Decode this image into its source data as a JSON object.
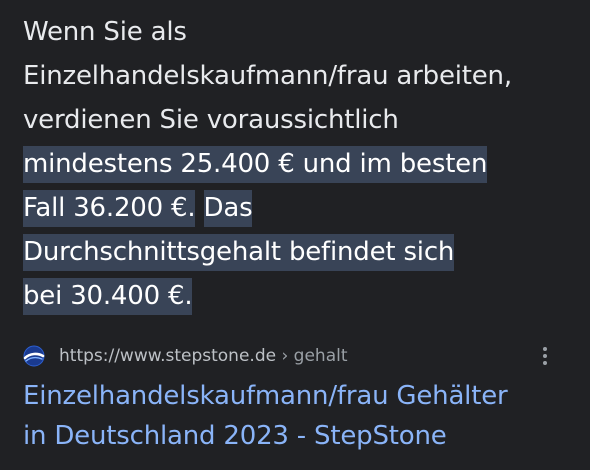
{
  "snippet": {
    "lines_plain": [
      "Wenn Sie als",
      "Einzelhandelskaufmann/frau arbeiten,",
      "verdienen Sie voraussichtlich"
    ],
    "lines_highlight": [
      "mindestens 25.400 € und im besten",
      "Fall 36.200 €.",
      "Das",
      "Durchschnittsgehalt befindet sich",
      "bei 30.400 €."
    ]
  },
  "source": {
    "url": "https://www.stepstone.de",
    "breadcrumb": " › gehalt",
    "favicon_icon": "stepstone-globe-icon"
  },
  "result": {
    "title_line1": "Einzelhandelskaufmann/frau Gehälter",
    "title_line2": "in Deutschland 2023 - StepStone"
  },
  "colors": {
    "background": "#202124",
    "text": "#e8eaed",
    "highlight": "#394457",
    "link": "#8ab4f8",
    "url": "#bdc1c6"
  }
}
